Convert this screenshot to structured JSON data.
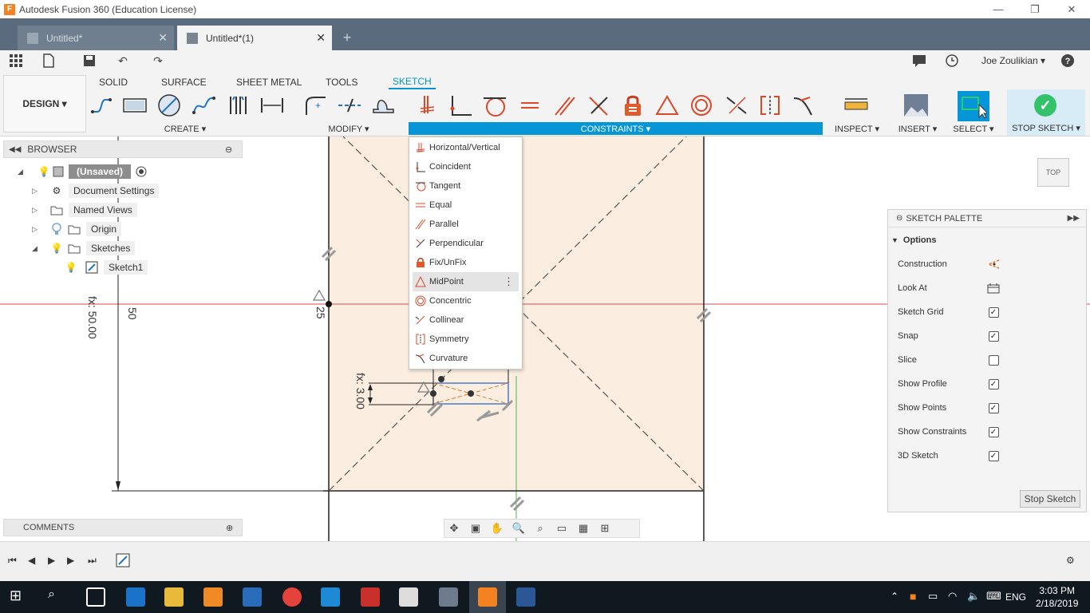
{
  "window": {
    "title": "Autodesk Fusion 360 (Education License)",
    "app_icon_letter": "F",
    "minimize": "—",
    "restore": "❐",
    "close": "✕"
  },
  "tabs": [
    {
      "label": "Untitled*",
      "active": false,
      "close": "✕"
    },
    {
      "label": "Untitled*(1)",
      "active": true,
      "close": "✕"
    }
  ],
  "new_tab": "+",
  "quick_access": {
    "user": "Joe Zoulikian ▾",
    "help": "?"
  },
  "ribbon": {
    "workspace": "DESIGN ▾",
    "tabs": [
      "SOLID",
      "SURFACE",
      "SHEET METAL",
      "TOOLS",
      "SKETCH"
    ],
    "active_tab": "SKETCH",
    "groups": {
      "create": "CREATE ▾",
      "modify": "MODIFY ▾",
      "constraints": "CONSTRAINTS ▾",
      "inspect": "INSPECT ▾",
      "insert": "INSERT ▾",
      "select": "SELECT ▾",
      "stop_sketch": "STOP SKETCH ▾"
    }
  },
  "browser": {
    "title": "BROWSER",
    "items": [
      {
        "label": "(Unsaved)"
      },
      {
        "label": "Document Settings"
      },
      {
        "label": "Named Views"
      },
      {
        "label": "Origin"
      },
      {
        "label": "Sketches"
      },
      {
        "label": "Sketch1"
      }
    ]
  },
  "constraints_menu": {
    "items": [
      {
        "label": "Horizontal/Vertical",
        "icon": "horizontal-vertical-icon"
      },
      {
        "label": "Coincident",
        "icon": "coincident-icon"
      },
      {
        "label": "Tangent",
        "icon": "tangent-icon"
      },
      {
        "label": "Equal",
        "icon": "equal-icon"
      },
      {
        "label": "Parallel",
        "icon": "parallel-icon"
      },
      {
        "label": "Perpendicular",
        "icon": "perpendicular-icon"
      },
      {
        "label": "Fix/UnFix",
        "icon": "lock-icon"
      },
      {
        "label": "MidPoint",
        "icon": "midpoint-icon"
      },
      {
        "label": "Concentric",
        "icon": "concentric-icon"
      },
      {
        "label": "Collinear",
        "icon": "collinear-icon"
      },
      {
        "label": "Symmetry",
        "icon": "symmetry-icon"
      },
      {
        "label": "Curvature",
        "icon": "curvature-icon"
      }
    ],
    "highlighted": "MidPoint",
    "more": "⋮"
  },
  "sketch_palette": {
    "title": "SKETCH PALETTE",
    "section": "Options",
    "options": [
      {
        "label": "Construction",
        "type": "icon",
        "icon": "construction-icon"
      },
      {
        "label": "Look At",
        "type": "icon",
        "icon": "look-at-icon"
      },
      {
        "label": "Sketch Grid",
        "type": "checkbox",
        "checked": true
      },
      {
        "label": "Snap",
        "type": "checkbox",
        "checked": true
      },
      {
        "label": "Slice",
        "type": "checkbox",
        "checked": false
      },
      {
        "label": "Show Profile",
        "type": "checkbox",
        "checked": true
      },
      {
        "label": "Show Points",
        "type": "checkbox",
        "checked": true
      },
      {
        "label": "Show Constraints",
        "type": "checkbox",
        "checked": true
      },
      {
        "label": "3D Sketch",
        "type": "checkbox",
        "checked": true
      }
    ],
    "stop_button": "Stop Sketch"
  },
  "comments": {
    "title": "COMMENTS"
  },
  "viewcube": {
    "face": "TOP"
  },
  "canvas": {
    "dims": {
      "d1": "fx: 50.00",
      "d2": "50",
      "d3": "25",
      "d4": "fx: 3.00"
    }
  },
  "taskbar": {
    "lang": "ENG",
    "time": "3:03 PM",
    "date": "2/18/2019"
  },
  "colors": {
    "accent": "#0696d7",
    "sketch_fill": "#fbeee0",
    "axis_red": "#d84b4b",
    "axis_green": "#48b848"
  }
}
